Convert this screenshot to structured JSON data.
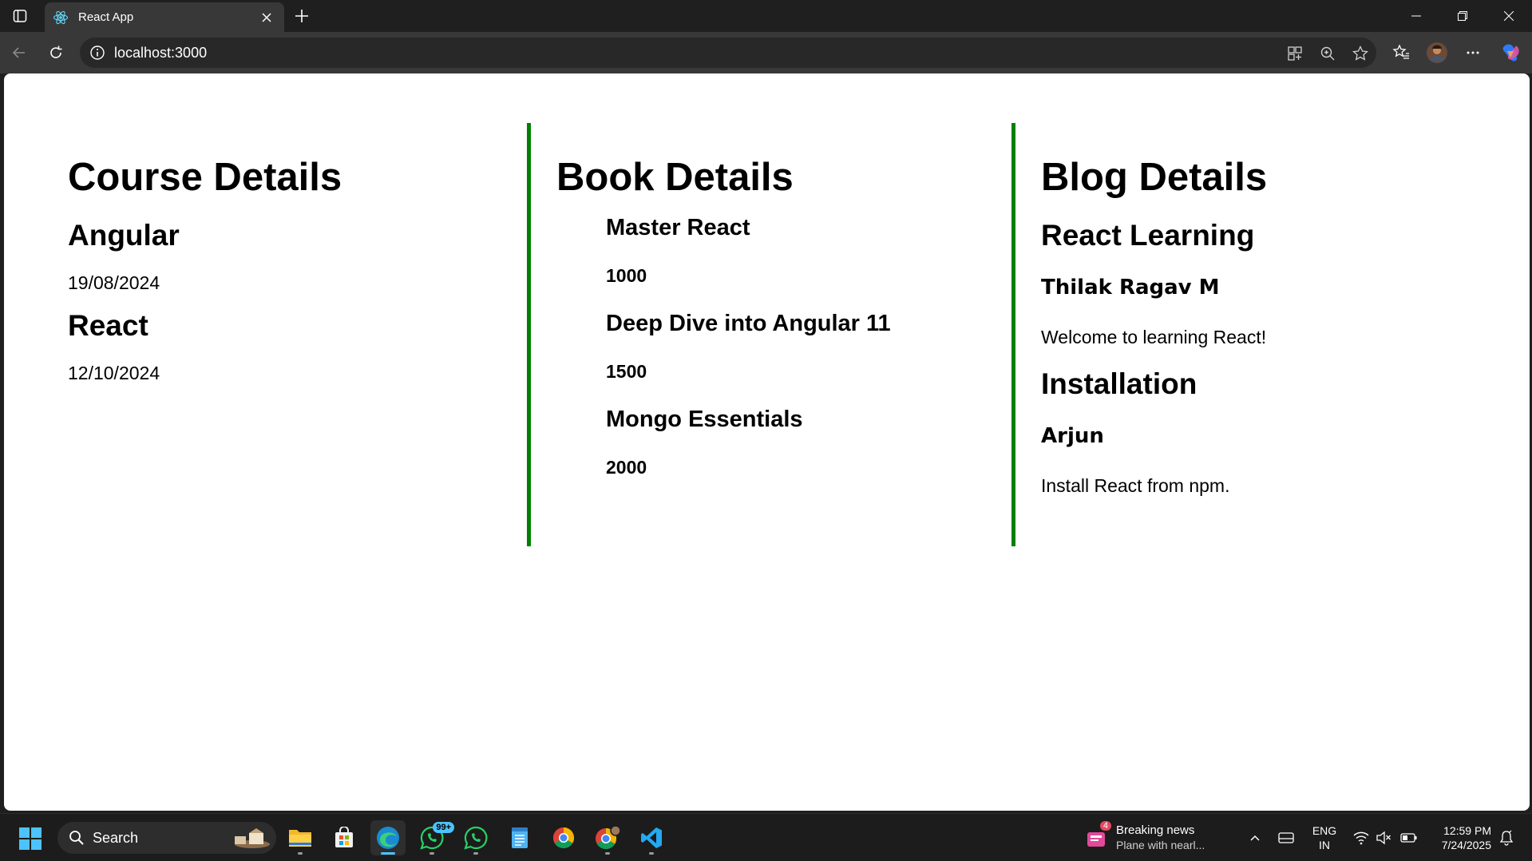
{
  "browser": {
    "tab_title": "React App",
    "url": "localhost:3000"
  },
  "course": {
    "heading": "Course Details",
    "items": [
      {
        "name": "Angular",
        "date": "19/08/2024"
      },
      {
        "name": "React",
        "date": "12/10/2024"
      }
    ]
  },
  "book": {
    "heading": "Book Details",
    "items": [
      {
        "title": "Master React",
        "price": "1000"
      },
      {
        "title": "Deep Dive into Angular 11",
        "price": "1500"
      },
      {
        "title": "Mongo Essentials",
        "price": "2000"
      }
    ]
  },
  "blog": {
    "heading": "Blog Details",
    "items": [
      {
        "title": "React Learning",
        "author": "Thilak Ragav M",
        "content": "Welcome to learning React!"
      },
      {
        "title": "Installation",
        "author": "Arjun",
        "content": "Install React from npm."
      }
    ]
  },
  "colors": {
    "section_divider": "#008000",
    "edge_accent": "#4cc2ff"
  },
  "taskbar": {
    "search_label": "Search",
    "whatsapp_badge": "99+",
    "news_count": "4",
    "news_title": "Breaking news",
    "news_sub": "Plane with nearl...",
    "lang_top": "ENG",
    "lang_bottom": "IN",
    "time": "12:59 PM",
    "date": "7/24/2025"
  }
}
